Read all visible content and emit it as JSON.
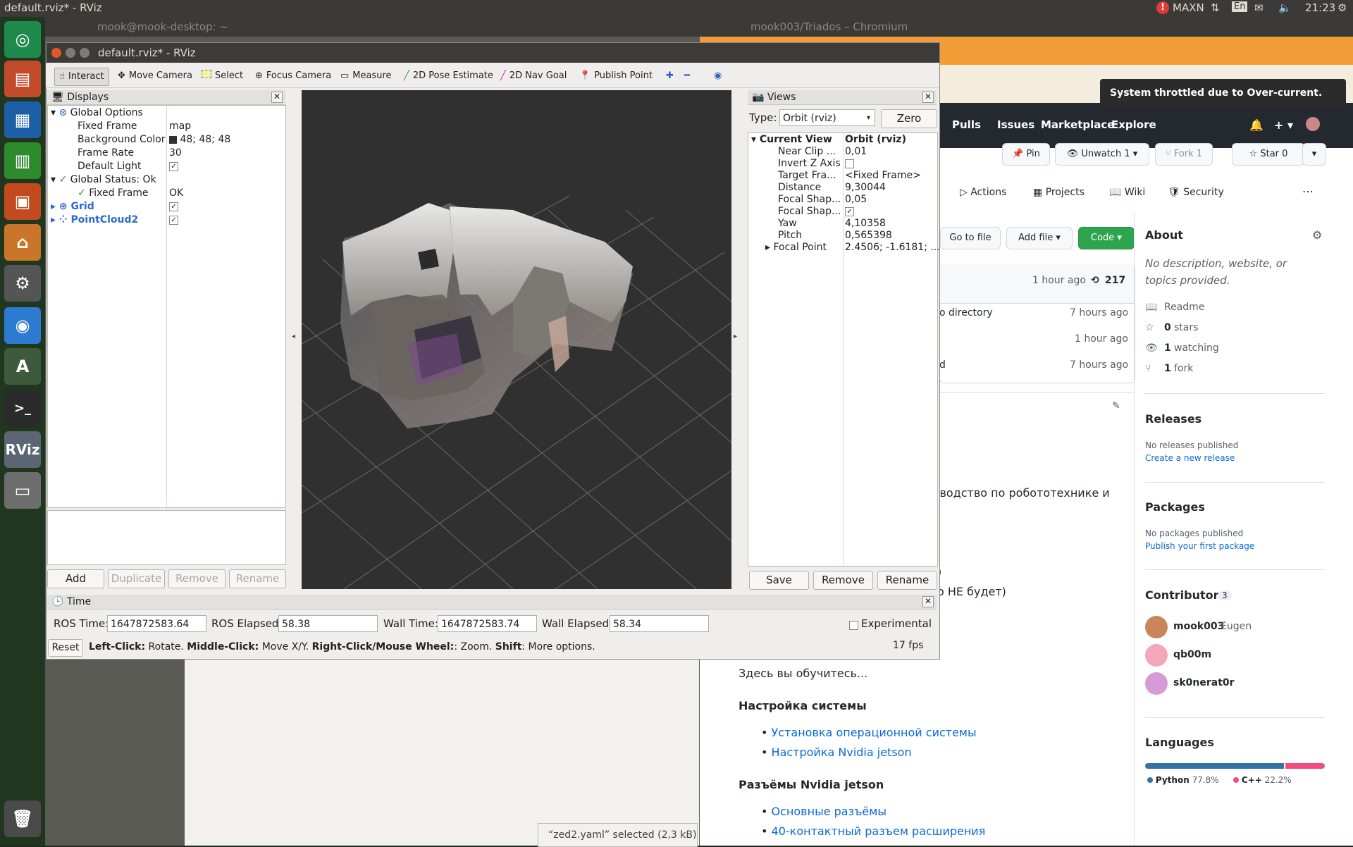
{
  "topbar": {
    "title": "default.rviz* - RViz",
    "power_mode": "MAXN",
    "keyboard": "En",
    "clock": "21:23"
  },
  "launcher": {
    "items": [
      "ubuntu-icon",
      "files-icon",
      "writer-icon",
      "calc-icon",
      "impress-icon",
      "software-center-icon",
      "settings-icon",
      "chromium-icon",
      "updater-icon",
      "terminal-icon",
      "rviz-icon",
      "drive-icon",
      "trash-icon"
    ],
    "rviz_label": "RViz"
  },
  "terminal_window": {
    "title": "mook@mook-desktop: ~"
  },
  "chrome_window": {
    "title": "mook003/Triados – Chromium",
    "nav": [
      "Pulls",
      "Issues",
      "Marketplace",
      "Explore"
    ],
    "pin": "Pin",
    "unwatch": "Unwatch",
    "unwatch_count": "1",
    "fork": "Fork",
    "fork_count": "1",
    "star": "Star",
    "star_count": "0",
    "tabs": [
      "Actions",
      "Projects",
      "Wiki",
      "Security"
    ],
    "goto_file": "Go to file",
    "add_file": "Add file",
    "code": "Code",
    "commit_time": "1 hour ago",
    "commit_count": "217",
    "files": [
      {
        "name": "o directory",
        "time": "7 hours ago"
      },
      {
        "name": "",
        "time": "1 hour ago"
      },
      {
        "name": "d",
        "time": "7 hours ago"
      }
    ],
    "readme_lines": [
      "ководство по робототехнике и",
      ")",
      "о НЕ будет)",
      "Здесь вы обучитесь..."
    ],
    "section1": "Настройка системы",
    "section1_links": [
      "Установка операционной системы",
      "Настройка Nvidia jetson"
    ],
    "section2": "Разъёмы Nvidia jetson",
    "section2_links": [
      "Основные разъёмы",
      "40-контактный разъем расширения"
    ],
    "about": {
      "title": "About",
      "desc": "No description, website, or topics provided.",
      "readme": "Readme",
      "stars_num": "0",
      "stars": "stars",
      "watching_num": "1",
      "watching": "watching",
      "fork_num": "1",
      "fork": "fork"
    },
    "releases": {
      "title": "Releases",
      "none": "No releases published",
      "link": "Create a new release"
    },
    "packages": {
      "title": "Packages",
      "none": "No packages published",
      "link": "Publish your first package"
    },
    "contributors": {
      "title": "Contributors",
      "count": "3",
      "list": [
        {
          "name": "mook003",
          "extra": "Eugen"
        },
        {
          "name": "qb00m",
          "extra": ""
        },
        {
          "name": "sk0nerat0r",
          "extra": ""
        }
      ]
    },
    "languages": {
      "title": "Languages",
      "items": [
        {
          "name": "Python",
          "pct": "77.8%",
          "value": 77.8,
          "color": "#3572A5"
        },
        {
          "name": "C++",
          "pct": "22.2%",
          "value": 22.2,
          "color": "#f34b7d"
        }
      ]
    }
  },
  "notification": "System throttled due to Over-current.",
  "file_selected": "“zed2.yaml” selected  (2,3 kB)",
  "rviz": {
    "window_title": "default.rviz* - RViz",
    "tools": [
      {
        "label": "Interact",
        "icon": "interact-icon"
      },
      {
        "label": "Move Camera",
        "icon": "move-camera-icon"
      },
      {
        "label": "Select",
        "icon": "select-icon"
      },
      {
        "label": "Focus Camera",
        "icon": "focus-camera-icon"
      },
      {
        "label": "Measure",
        "icon": "measure-icon"
      },
      {
        "label": "2D Pose Estimate",
        "icon": "pose-estimate-icon"
      },
      {
        "label": "2D Nav Goal",
        "icon": "nav-goal-icon"
      },
      {
        "label": "Publish Point",
        "icon": "publish-point-icon"
      }
    ],
    "displays": {
      "title": "Displays",
      "rows": [
        {
          "name": "Global Options",
          "value": ""
        },
        {
          "name": "Fixed Frame",
          "value": "map"
        },
        {
          "name": "Background Color",
          "value": "48; 48; 48"
        },
        {
          "name": "Frame Rate",
          "value": "30"
        },
        {
          "name": "Default Light",
          "value": "✓"
        },
        {
          "name": "Global Status: Ok",
          "value": ""
        },
        {
          "name": "Fixed Frame",
          "value": "OK"
        },
        {
          "name": "Grid",
          "value": "✓"
        },
        {
          "name": "PointCloud2",
          "value": "✓"
        }
      ],
      "buttons": [
        "Add",
        "Duplicate",
        "Remove",
        "Rename"
      ]
    },
    "views": {
      "title": "Views",
      "type_label": "Type:",
      "type_value": "Orbit (rviz)",
      "zero": "Zero",
      "rows": [
        {
          "name": "Current View",
          "value": "Orbit (rviz)"
        },
        {
          "name": "Near Clip ...",
          "value": "0,01"
        },
        {
          "name": "Invert Z Axis",
          "value": ""
        },
        {
          "name": "Target Fra...",
          "value": "<Fixed Frame>"
        },
        {
          "name": "Distance",
          "value": "9,30044"
        },
        {
          "name": "Focal Shap...",
          "value": "0,05"
        },
        {
          "name": "Focal Shap...",
          "value": "✓"
        },
        {
          "name": "Yaw",
          "value": "4,10358"
        },
        {
          "name": "Pitch",
          "value": "0,565398"
        },
        {
          "name": "Focal Point",
          "value": "2.4506; -1.6181; ..."
        }
      ],
      "buttons": [
        "Save",
        "Remove",
        "Rename"
      ]
    },
    "time": {
      "title": "Time",
      "ros_time_label": "ROS Time:",
      "ros_time": "1647872583.64",
      "ros_elapsed_label": "ROS Elapsed:",
      "ros_elapsed": "58.38",
      "wall_time_label": "Wall Time:",
      "wall_time": "1647872583.74",
      "wall_elapsed_label": "Wall Elapsed:",
      "wall_elapsed": "58.34",
      "experimental": "Experimental"
    },
    "status": {
      "reset": "Reset",
      "left": "Left-Click:",
      "left_t": " Rotate. ",
      "middle": "Middle-Click:",
      "middle_t": " Move X/Y. ",
      "right": "Right-Click/Mouse Wheel:",
      "right_t": ": Zoom. ",
      "shift": "Shift",
      "shift_t": ": More options.",
      "fps": "17 fps"
    }
  }
}
